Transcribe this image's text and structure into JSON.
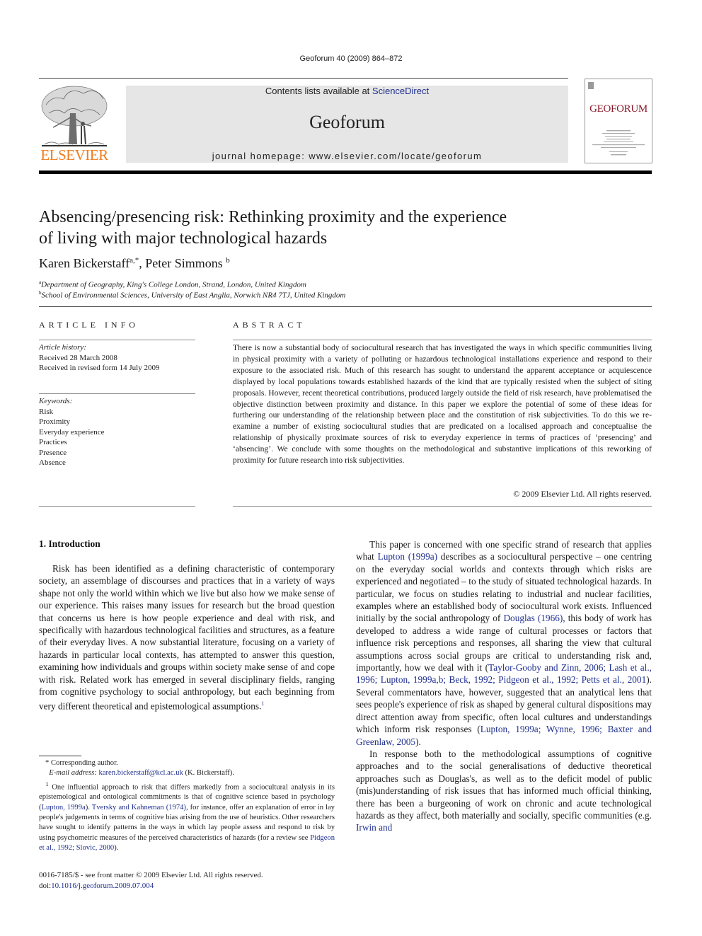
{
  "running_head": "Geoforum 40 (2009) 864–872",
  "masthead": {
    "contents_prefix": "Contents lists available at ",
    "contents_link": "ScienceDirect",
    "journal_name": "Geoforum",
    "homepage_label": "journal homepage: www.elsevier.com/locate/geoforum",
    "publisher_logo_text": "ELSEVIER",
    "cover_title": "GEOFORUM"
  },
  "colors": {
    "publisher_orange": "#f07d1f",
    "link_blue": "#1f2f8f",
    "cover_red": "#8a1c2b",
    "masthead_gray": "#e6e6e6"
  },
  "article": {
    "title_line1": "Absencing/presencing risk: Rethinking proximity and the experience",
    "title_line2": "of living with major technological hazards",
    "authors": [
      {
        "name": "Karen Bickerstaff",
        "marks": "a,*"
      },
      {
        "name": "Peter Simmons",
        "marks": "b"
      }
    ],
    "author_separator": ", ",
    "affiliations": [
      {
        "mark": "a",
        "text": "Department of Geography, King's College London, Strand, London, United Kingdom"
      },
      {
        "mark": "b",
        "text": "School of Environmental Sciences, University of East Anglia, Norwich NR4 7TJ, United Kingdom"
      }
    ]
  },
  "article_info": {
    "heading": "ARTICLE INFO",
    "history_label": "Article history:",
    "history": [
      "Received 28 March 2008",
      "Received in revised form 14 July 2009"
    ],
    "keywords_label": "Keywords:",
    "keywords": [
      "Risk",
      "Proximity",
      "Everyday experience",
      "Practices",
      "Presence",
      "Absence"
    ]
  },
  "abstract": {
    "heading": "ABSTRACT",
    "text": "There is now a substantial body of sociocultural research that has investigated the ways in which specific communities living in physical proximity with a variety of polluting or hazardous technological installations experience and respond to their exposure to the associated risk. Much of this research has sought to understand the apparent acceptance or acquiescence displayed by local populations towards established hazards of the kind that are typically resisted when the subject of siting proposals. However, recent theoretical contributions, produced largely outside the field of risk research, have problematised the objective distinction between proximity and distance. In this paper we explore the potential of some of these ideas for furthering our understanding of the relationship between place and the constitution of risk subjectivities. To do this we re-examine a number of existing sociocultural studies that are predicated on a localised approach and conceptualise the relationship of physically proximate sources of risk to everyday experience in terms of practices of ‘presencing’ and ‘absencing’. We conclude with some thoughts on the methodological and substantive implications of this reworking of proximity for future research into risk subjectivities.",
    "copyright": "© 2009 Elsevier Ltd. All rights reserved."
  },
  "intro": {
    "heading": "1. Introduction",
    "p1": "Risk has been identified as a defining characteristic of contemporary society, an assemblage of discourses and practices that in a variety of ways shape not only the world within which we live but also how we make sense of our experience. This raises many issues for research but the broad question that concerns us here is how people experience and deal with risk, and specifically with hazardous technological facilities and structures, as a feature of their everyday lives. A now substantial literature, focusing on a variety of hazards in particular local contexts, has attempted to answer this question, examining how individuals and groups within society make sense of and cope with risk. Related work has emerged in several disciplinary fields, ranging from cognitive psychology to social anthropology, but each beginning from very different theoretical and epistemological assumptions.",
    "p1_footnote_mark": "1",
    "p2": {
      "t1": "This paper is concerned with one specific strand of research that applies what ",
      "l1": "Lupton (1999a)",
      "t2": " describes as a sociocultural perspective – one centring on the everyday social worlds and contexts through which risks are experienced and negotiated – to the study of situated technological hazards. In particular, we focus on studies relating to industrial and nuclear facilities, examples where an established body of sociocultural work exists. Influenced initially by the social anthropology of ",
      "l2": "Douglas (1966)",
      "t3": ", this body of work has developed to address a wide range of cultural processes or factors that influence risk perceptions and responses, all sharing the view that cultural assumptions across social groups are critical to understanding risk and, importantly, how we deal with it (",
      "l3": "Taylor-Gooby and Zinn, 2006; Lash et al., 1996; Lupton, 1999a,b; Beck, 1992; Pidgeon et al., 1992; Petts et al., 2001",
      "t4": "). Several commentators have, however, suggested that an analytical lens that sees people's experience of risk as shaped by general cultural dispositions may direct attention away from specific, often local cultures and understandings which inform risk responses (",
      "l4": "Lupton, 1999a; Wynne, 1996; Baxter and Greenlaw, 2005",
      "t5": ")."
    },
    "p3": {
      "t1": "In response both to the methodological assumptions of cognitive approaches and to the social generalisations of deductive theoretical approaches such as Douglas's, as well as to the deficit model of public (mis)understanding of risk issues that has informed much official thinking, there has been a burgeoning of work on chronic and acute technological hazards as they affect, both materially and socially, specific communities (e.g. ",
      "l1": "Irwin and"
    }
  },
  "footnotes": {
    "corresponding_mark": "*",
    "corresponding": "Corresponding author.",
    "email_label": "E-mail address:",
    "email": "karen.bickerstaff@kcl.ac.uk",
    "email_suffix": " (K. Bickerstaff).",
    "fn1_mark": "1",
    "fn1": {
      "t1": " One influential approach to risk that differs markedly from a sociocultural analysis in its epistemological and ontological commitments is that of cognitive science based in psychology (",
      "l1": "Lupton, 1999a",
      "t2": "). ",
      "l2": "Tversky and Kahneman (1974)",
      "t3": ", for instance, offer an explanation of error in lay people's judgements in terms of cognitive bias arising from the use of heuristics. Other researchers have sought to identify patterns in the ways in which lay people assess and respond to risk by using psychometric measures of the perceived characteristics of hazards (for a review see ",
      "l3": "Pidgeon et al., 1992; Slovic, 2000",
      "t4": ")."
    }
  },
  "front_matter": {
    "issn_line": "0016-7185/$ - see front matter © 2009 Elsevier Ltd. All rights reserved.",
    "doi_label": "doi:",
    "doi": "10.1016/j.geoforum.2009.07.004"
  }
}
